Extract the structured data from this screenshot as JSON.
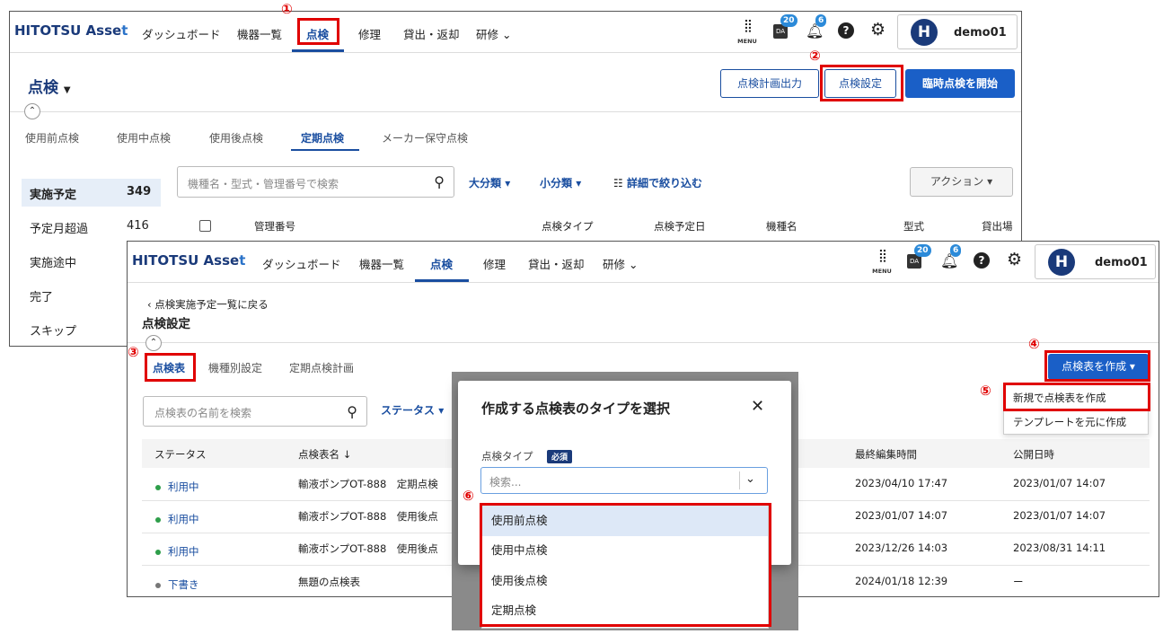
{
  "app": {
    "logo_main": "HITOTSU Asse",
    "logo_end": "t",
    "user_initial": "H",
    "user_name": "demo01",
    "menu_label": "MENU",
    "badge_da": "20",
    "badge_notif": "6",
    "nav": [
      "ダッシュボード",
      "機器一覧",
      "点検",
      "修理",
      "貸出・返却",
      "研修"
    ]
  },
  "steps": [
    "①",
    "②",
    "③",
    "④",
    "⑤",
    "⑥"
  ],
  "back": {
    "title": "点検",
    "buttons": {
      "plan_output": "点検計画出力",
      "settings": "点検設定",
      "start_adhoc": "臨時点検を開始"
    },
    "tabs": [
      "使用前点検",
      "使用中点検",
      "使用後点検",
      "定期点検",
      "メーカー保守点検"
    ],
    "sidebar": [
      {
        "label": "実施予定",
        "count": "349"
      },
      {
        "label": "予定月超過",
        "count": "416"
      },
      {
        "label": "実施途中",
        "count": ""
      },
      {
        "label": "完了",
        "count": ""
      },
      {
        "label": "スキップ",
        "count": ""
      }
    ],
    "search_placeholder": "機種名・型式・管理番号で検索",
    "filters": {
      "major": "大分類",
      "minor": "小分類",
      "detail": "詳細で絞り込む",
      "action": "アクション"
    },
    "columns": [
      "管理番号",
      "点検タイプ",
      "点検予定日",
      "機種名",
      "型式",
      "貸出場"
    ]
  },
  "front": {
    "back_link": "点検実施予定一覧に戻る",
    "title": "点検設定",
    "tabs": [
      "点検表",
      "機種別設定",
      "定期点検計画"
    ],
    "create_button": "点検表を作成",
    "create_menu": [
      "新規で点検表を作成",
      "テンプレートを元に作成"
    ],
    "search_placeholder": "点検表の名前を検索",
    "status_filter": "ステータス",
    "columns": {
      "status": "ステータス",
      "name": "点検表名 ↓",
      "edited": "最終編集時間",
      "published": "公開日時"
    },
    "rows": [
      {
        "status": "利用中",
        "status_color": "#2e9e4a",
        "name": "輸液ポンプOT-888　定期点検",
        "edited": "2023/04/10 17:47",
        "published": "2023/01/07 14:07"
      },
      {
        "status": "利用中",
        "status_color": "#2e9e4a",
        "name": "輸液ポンプOT-888　使用後点",
        "edited": "2023/01/07 14:07",
        "published": "2023/01/07 14:07"
      },
      {
        "status": "利用中",
        "status_color": "#2e9e4a",
        "name": "輸液ポンプOT-888　使用後点",
        "edited": "2023/12/26 14:03",
        "published": "2023/08/31 14:11"
      },
      {
        "status": "下書き",
        "status_color": "#777777",
        "name": "無題の点検表",
        "edited": "2024/01/18 12:39",
        "published": "ー"
      }
    ]
  },
  "modal": {
    "title": "作成する点検表のタイプを選択",
    "field_label": "点検タイプ",
    "required": "必須",
    "placeholder": "検索...",
    "options": [
      "使用前点検",
      "使用中点検",
      "使用後点検",
      "定期点検"
    ]
  },
  "colors": {
    "primary": "#1a4ea0",
    "highlight": "#e00000"
  }
}
